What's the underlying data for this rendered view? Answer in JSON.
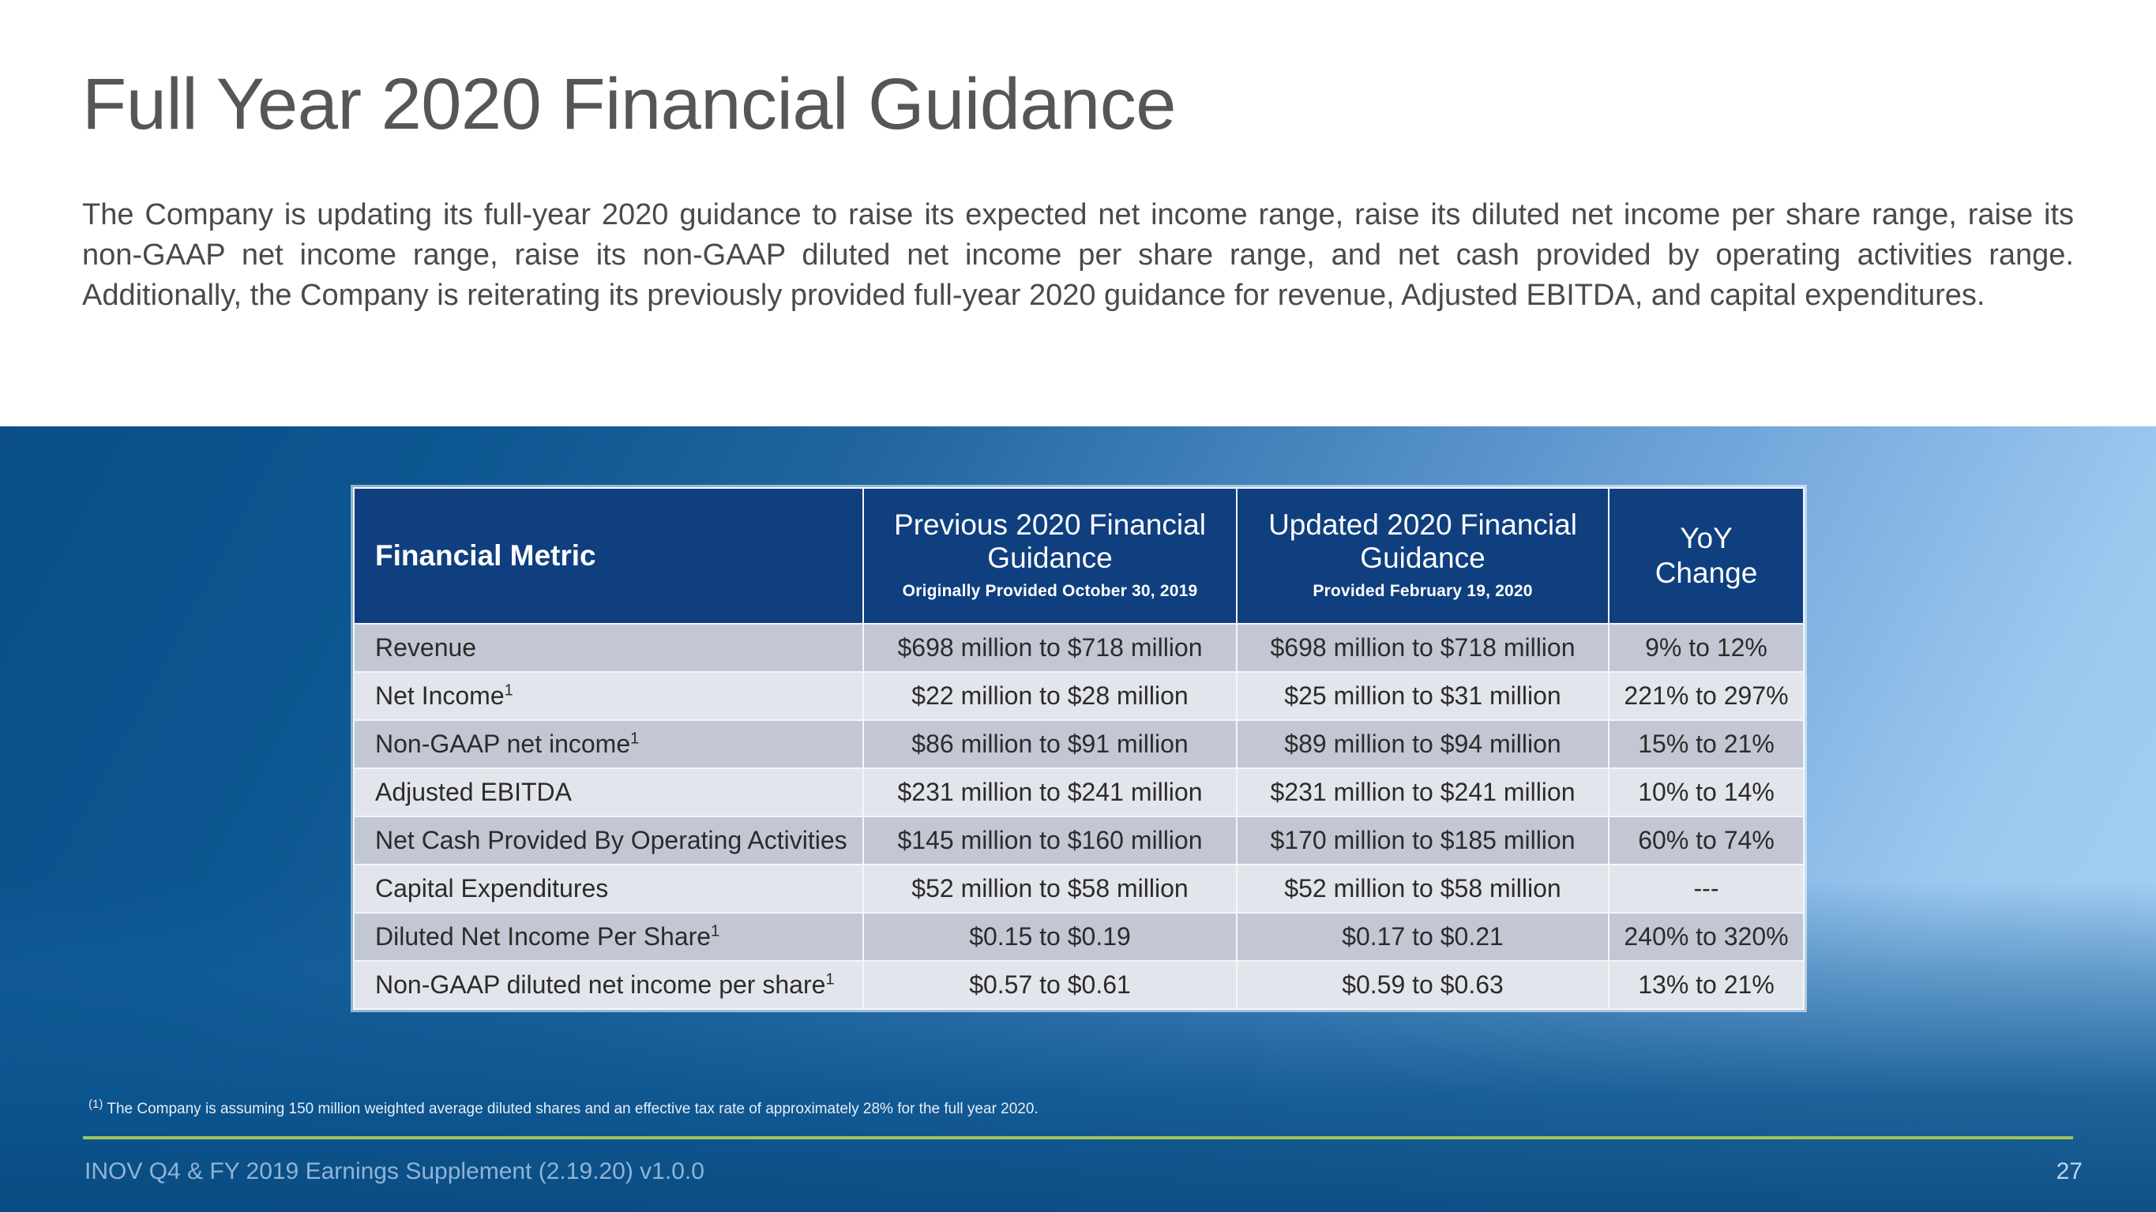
{
  "slide": {
    "title": "Full Year 2020 Financial Guidance",
    "intro": "The Company is updating its full-year 2020 guidance to raise its expected net income range, raise its diluted net income per share range, raise its non-GAAP net income range, raise its non-GAAP diluted net income per share range, and net cash provided by operating activities range. Additionally, the Company is reiterating its previously provided full-year 2020 guidance for revenue, Adjusted EBITDA, and capital expenditures."
  },
  "table": {
    "headers": {
      "metric": "Financial Metric",
      "previous_main": "Previous 2020 Financial Guidance",
      "previous_sub": "Originally Provided October 30, 2019",
      "updated_main": "Updated 2020 Financial Guidance",
      "updated_sub": "Provided February 19, 2020",
      "yoy_line1": "YoY",
      "yoy_line2": "Change"
    },
    "rows": [
      {
        "metric": "Revenue",
        "footnote_mark": "",
        "previous": "$698 million to $718 million",
        "updated": "$698 million to $718 million",
        "yoy": "9% to 12%"
      },
      {
        "metric": "Net Income",
        "footnote_mark": "1",
        "previous": "$22 million to $28 million",
        "updated": "$25 million to $31 million",
        "yoy": "221% to 297%"
      },
      {
        "metric": "Non-GAAP net income",
        "footnote_mark": "1",
        "previous": "$86 million to $91 million",
        "updated": "$89 million to $94 million",
        "yoy": "15% to 21%"
      },
      {
        "metric": "Adjusted EBITDA",
        "footnote_mark": "",
        "previous": "$231 million to $241 million",
        "updated": "$231 million to $241 million",
        "yoy": "10% to 14%"
      },
      {
        "metric": "Net Cash Provided By Operating Activities",
        "footnote_mark": "",
        "previous": "$145  million to $160 million",
        "updated": "$170  million to $185 million",
        "yoy": "60% to 74%"
      },
      {
        "metric": "Capital Expenditures",
        "footnote_mark": "",
        "previous": "$52 million to $58 million",
        "updated": "$52 million to $58 million",
        "yoy": "---"
      },
      {
        "metric": "Diluted Net Income Per Share",
        "footnote_mark": "1",
        "previous": "$0.15  to $0.19",
        "updated": "$0.17  to $0.21",
        "yoy": "240% to 320%"
      },
      {
        "metric": "Non-GAAP diluted net income per share",
        "footnote_mark": "1",
        "previous": "$0.57  to $0.61",
        "updated": "$0.59  to $0.63",
        "yoy": "13% to 21%"
      }
    ]
  },
  "footnote": {
    "mark": "(1)",
    "text": "The Company is assuming 150 million weighted average diluted shares and an effective tax rate of approximately 28% for the full year 2020."
  },
  "footer": {
    "text": "INOV Q4 & FY 2019  Earnings Supplement (2.19.20) v1.0.0",
    "page_number": "27"
  },
  "colors": {
    "header_blue": "#0f3f7f",
    "band_dark_blue": "#0c5691",
    "band_light_blue": "#9bc8ef",
    "green_rule": "#9fc45c",
    "title_gray": "#565656",
    "row_shade_a": "#c3c7d4",
    "row_shade_b": "#e3e5ec"
  }
}
